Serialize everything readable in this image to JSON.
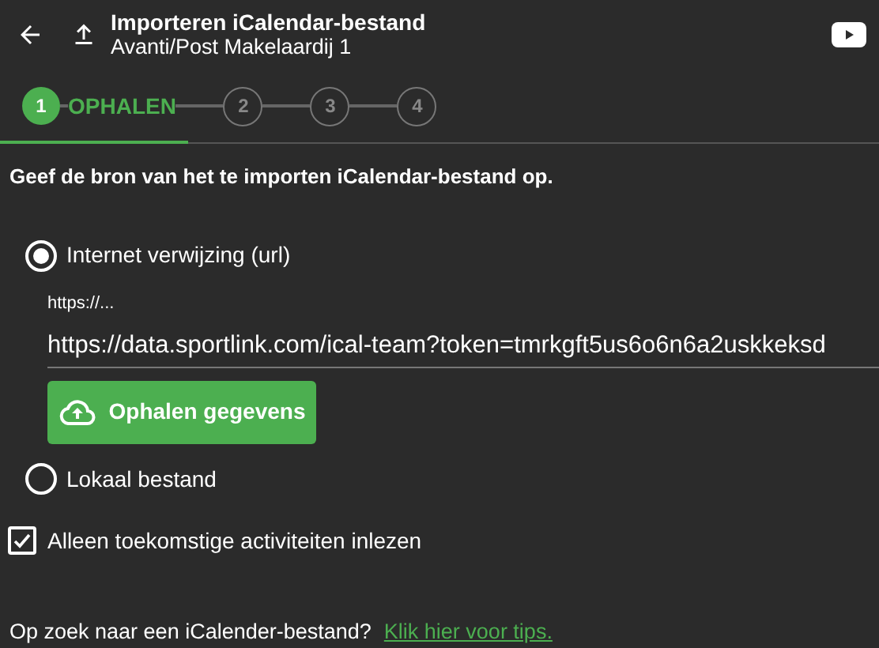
{
  "header": {
    "title": "Importeren iCalendar-bestand",
    "subtitle": "Avanti/Post Makelaardij 1"
  },
  "steps": [
    {
      "number": "1",
      "label": "OPHALEN",
      "selected": true
    },
    {
      "number": "2",
      "selected": false
    },
    {
      "number": "3",
      "selected": false
    },
    {
      "number": "4",
      "selected": false
    }
  ],
  "instruction": "Geef de bron van het te importen iCalendar-bestand op.",
  "sources": [
    {
      "label": "Internet verwijzing (url)",
      "selected": true
    },
    {
      "label": "Lokaal bestand",
      "selected": false
    }
  ],
  "url_field": {
    "label": "https://...",
    "value": "https://data.sportlink.com/ical-team?token=tmrkgft5us6o6n6a2uskkeksd"
  },
  "fetch_button": "Ophalen gegevens",
  "future_only": {
    "label": "Alleen toekomstige activiteiten inlezen",
    "checked": true
  },
  "footer": {
    "text": "Op zoek naar een iCalender-bestand?",
    "link": "Klik hier voor tips."
  }
}
